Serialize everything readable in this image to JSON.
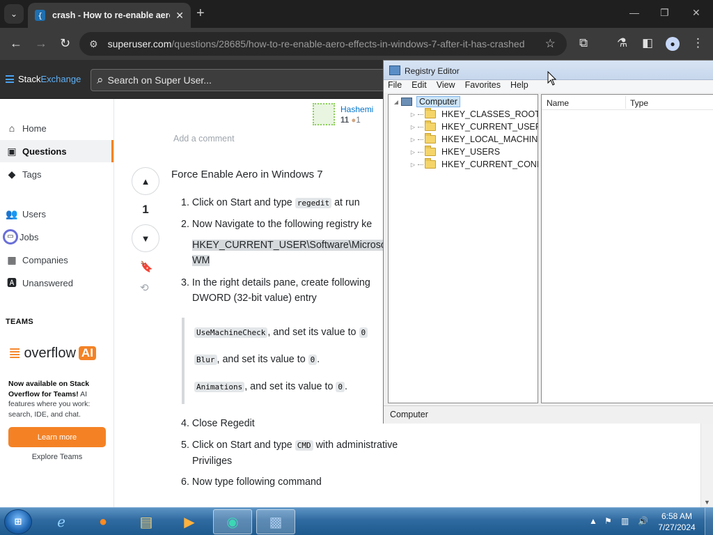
{
  "browser": {
    "tab_title": "crash - How to re-enable aero",
    "url_host": "superuser.com",
    "url_path": "/questions/28685/how-to-re-enable-aero-effects-in-windows-7-after-it-has-crashed"
  },
  "se": {
    "logo_a": "Stack",
    "logo_b": "Exchange",
    "search_placeholder": "Search on Super User..."
  },
  "nav": {
    "home": "Home",
    "questions": "Questions",
    "tags": "Tags",
    "users": "Users",
    "jobs": "Jobs",
    "companies": "Companies",
    "unanswered": "Unanswered",
    "teams_heading": "TEAMS",
    "oai_word": "overflow",
    "oai_badge": "AI",
    "oai_bold": "Now available on Stack Overflow for Teams!",
    "oai_rest": " AI features where you work: search, IDE, and chat.",
    "learn_more": "Learn more",
    "explore_teams": "Explore Teams"
  },
  "post": {
    "commenter_name": "Hashemi",
    "commenter_rep": "11",
    "commenter_bronze": "1",
    "add_comment": "Add a comment",
    "vote_count": "1",
    "title": "Force Enable Aero in Windows 7",
    "s1_num": "1.",
    "s1_pre": "Click on Start and type",
    "s1_code": "regedit",
    "s1_post": "at run",
    "s2_num": "2.",
    "s2_text": "Now Navigate to the following registry ke",
    "reg_path_1": "HKEY_CURRENT_USER\\Software\\Microsof",
    "reg_path_2": "WM",
    "s3_num": "3.",
    "s3_line1": "In the right details pane, create following",
    "s3_line2": "DWORD (32-bit value) entry",
    "q1_code": "UseMachineCheck",
    "q1_text": ", and set its value to",
    "q1_val": "0",
    "q2_code": "Blur",
    "q2_text": ", and set its value to",
    "q2_val": "0",
    "q3_code": "Animations",
    "q3_text": ", and set its value to",
    "q3_val": "0",
    "s4_num": "4.",
    "s4_text": "Close Regedit",
    "s5_num": "5.",
    "s5_pre": "Click on Start and type",
    "s5_code": "CMD",
    "s5_post": "with administrative",
    "s5_line2": "Priviliges",
    "s6_num": "6.",
    "s6_text": "Now type following command"
  },
  "regedit": {
    "title": "Registry Editor",
    "menu": [
      "File",
      "Edit",
      "View",
      "Favorites",
      "Help"
    ],
    "root": "Computer",
    "keys": [
      "HKEY_CLASSES_ROOT",
      "HKEY_CURRENT_USER",
      "HKEY_LOCAL_MACHINE",
      "HKEY_USERS",
      "HKEY_CURRENT_CONFIG"
    ],
    "col_name": "Name",
    "col_type": "Type",
    "status": "Computer"
  },
  "taskbar": {
    "time": "6:58 AM",
    "date": "7/27/2024"
  }
}
